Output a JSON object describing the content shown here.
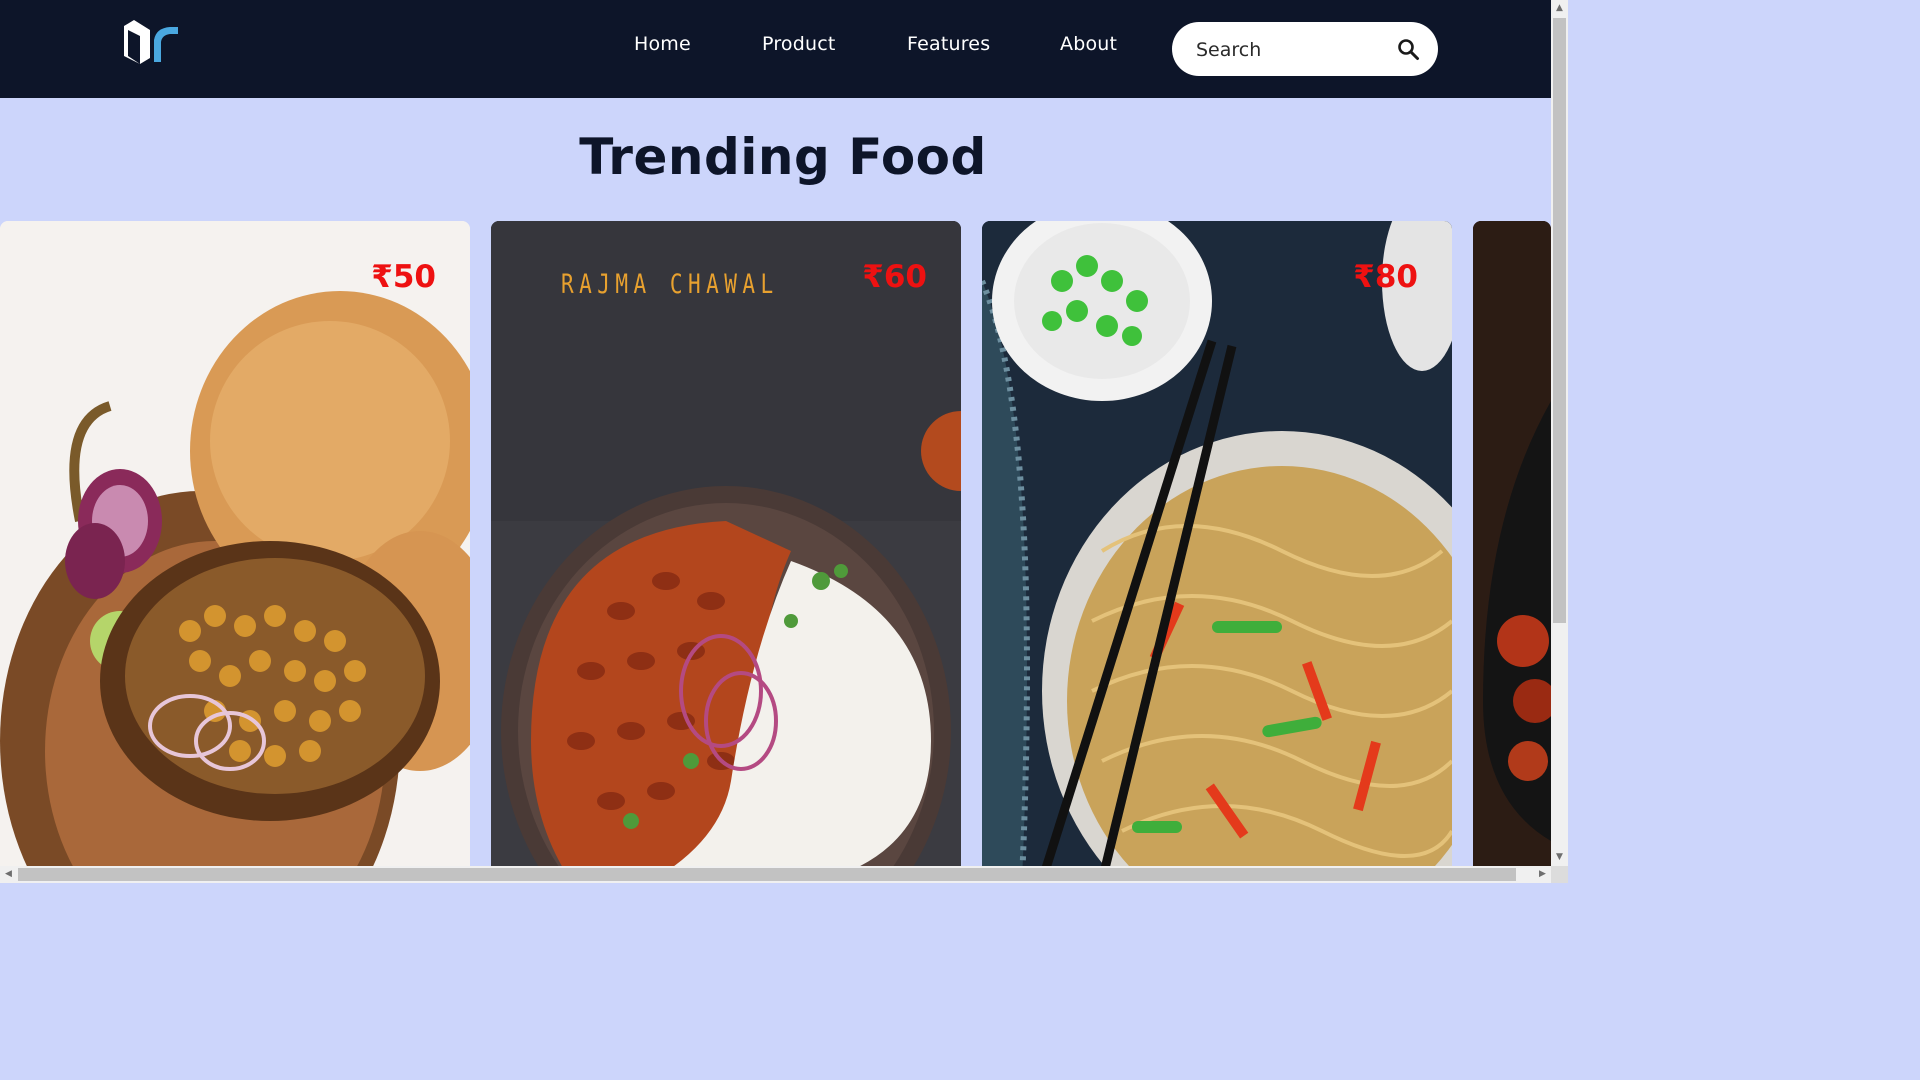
{
  "nav": {
    "links": [
      "Home",
      "Product",
      "Features",
      "About"
    ],
    "search_placeholder": "Search"
  },
  "page_title": "Trending Food",
  "cards": [
    {
      "price": "₹50",
      "caption": ""
    },
    {
      "price": "₹60",
      "caption": "RAJMA CHAWAL"
    },
    {
      "price": "₹80",
      "caption": ""
    },
    {
      "price": "",
      "caption": ""
    }
  ],
  "colors": {
    "navbar": "#0d1529",
    "page_background": "#ccd5fb",
    "price": "#ee1111",
    "logo_accent": "#4aa8e0"
  },
  "icons": [
    "logo",
    "search-icon"
  ]
}
